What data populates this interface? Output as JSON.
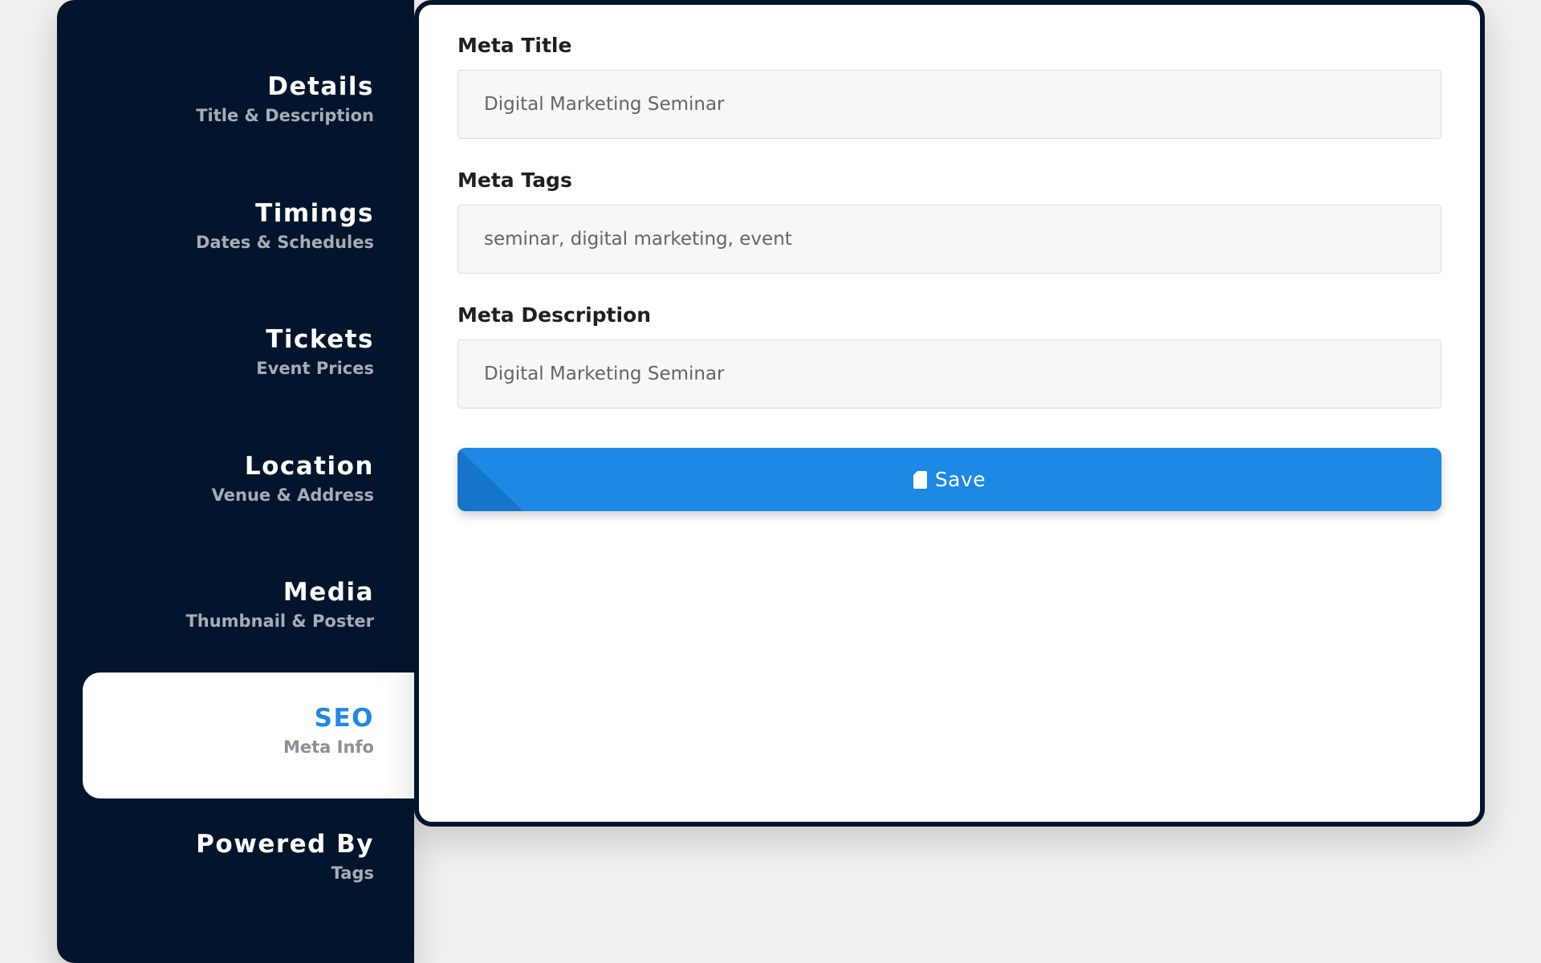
{
  "sidebar": {
    "items": [
      {
        "title": "Details",
        "subtitle": "Title & Description",
        "active": false
      },
      {
        "title": "Timings",
        "subtitle": "Dates & Schedules",
        "active": false
      },
      {
        "title": "Tickets",
        "subtitle": "Event Prices",
        "active": false
      },
      {
        "title": "Location",
        "subtitle": "Venue & Address",
        "active": false
      },
      {
        "title": "Media",
        "subtitle": "Thumbnail & Poster",
        "active": false
      },
      {
        "title": "SEO",
        "subtitle": "Meta Info",
        "active": true
      },
      {
        "title": "Powered By",
        "subtitle": "Tags",
        "active": false
      }
    ]
  },
  "form": {
    "meta_title": {
      "label": "Meta Title",
      "value": "Digital Marketing Seminar"
    },
    "meta_tags": {
      "label": "Meta Tags",
      "value": "seminar, digital marketing, event"
    },
    "meta_description": {
      "label": "Meta Description",
      "value": "Digital Marketing Seminar"
    },
    "save": {
      "label": "Save",
      "icon": "sd-card-icon"
    }
  },
  "colors": {
    "sidebar_bg": "#03152d",
    "accent": "#1e88e5",
    "card_bg": "#ffffff",
    "page_bg": "#f0f0f1"
  }
}
